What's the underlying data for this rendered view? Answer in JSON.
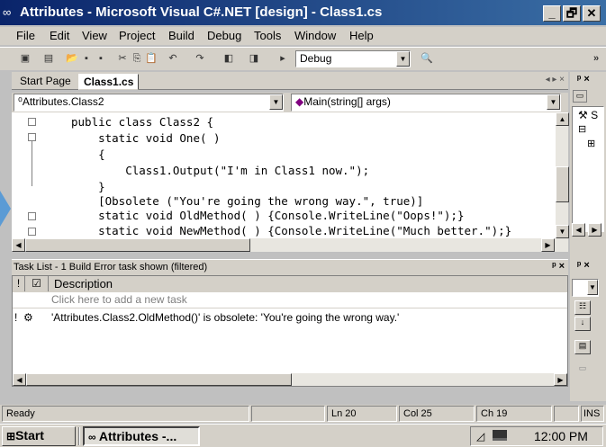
{
  "window": {
    "title": "Attributes - Microsoft Visual C#.NET [design] - Class1.cs",
    "minimize": "_",
    "maximize": "🗗",
    "close": "✕"
  },
  "menu": [
    {
      "label": "File"
    },
    {
      "label": "Edit"
    },
    {
      "label": "View"
    },
    {
      "label": "Project"
    },
    {
      "label": "Build"
    },
    {
      "label": "Debug"
    },
    {
      "label": "Tools"
    },
    {
      "label": "Window"
    },
    {
      "label": "Help"
    }
  ],
  "toolbar": {
    "configuration": "Debug",
    "overflow": "»"
  },
  "editor": {
    "tabs": [
      "Start Page",
      "Class1.cs"
    ],
    "active_tab": "Class1.cs",
    "tab_nav": "◂ ▸ ×",
    "class_combo": "Attributes.Class2",
    "member_combo": "Main(string[] args)",
    "code_lines": [
      "public class Class2 {",
      "    static void One( )",
      "    {",
      "        Class1.Output(\"I'm in Class1 now.\");",
      "    }",
      "    [Obsolete (\"You're going the wrong way.\", true)]",
      "    static void OldMethod( ) {Console.WriteLine(\"Oops!\");}",
      "    static void NewMethod( ) {Console.WriteLine(\"Much better.\");}"
    ]
  },
  "tasklist": {
    "header": "Task List - 1 Build Error task shown (filtered)",
    "pin": "ᵖ ×",
    "col_description": "Description",
    "add_placeholder": "Click here to add a new task",
    "tasks": [
      {
        "description": "'Attributes.Class2.OldMethod()' is obsolete: 'You're going the wrong way.'"
      }
    ]
  },
  "statusbar": {
    "status": "Ready",
    "line": "Ln 20",
    "col": "Col 25",
    "ch": "Ch 19",
    "mode": "INS"
  },
  "taskbar": {
    "start": "Start",
    "task": "Attributes -...",
    "clock": "12:00 PM"
  },
  "rightpanel": {
    "pin": "ᵖ ×",
    "tree_label": "S"
  }
}
